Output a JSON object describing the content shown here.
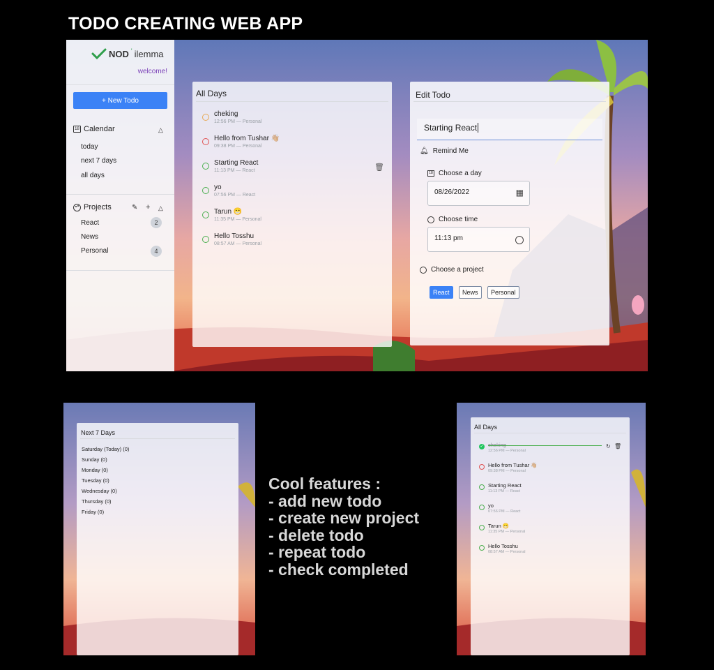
{
  "headline": "TODO CREATING WEB APP",
  "colors": {
    "accent": "#3b82f6",
    "brand_check": "#2e9e4a",
    "welcome": "#7a3fb7",
    "background": "#000000"
  },
  "app": {
    "logo": {
      "icon": "check-icon",
      "nod": "NOD",
      "d": "'",
      "rest": "ilemma"
    },
    "welcome": "welcome!",
    "new_todo_label": "+ New Todo",
    "calendar": {
      "title": "Calendar",
      "icon": "calendar-icon",
      "items": [
        "today",
        "next 7 days",
        "all days"
      ]
    },
    "projects": {
      "title": "Projects",
      "icon": "palette-icon",
      "items": [
        {
          "name": "React",
          "count": "2"
        },
        {
          "name": "News",
          "count": ""
        },
        {
          "name": "Personal",
          "count": "4"
        }
      ]
    },
    "list_panel": {
      "title": "All Days",
      "todos": [
        {
          "text": "cheking",
          "meta": "12:56 PM — Personal",
          "circle_color": "#e8a854"
        },
        {
          "text": "Hello from Tushar 👋🏼",
          "meta": "09:38 PM — Personal",
          "circle_color": "#e05252"
        },
        {
          "text": "Starting React",
          "meta": "11:13 PM — React",
          "circle_color": "#4caf50"
        },
        {
          "text": "yo",
          "meta": "07:56 PM — React",
          "circle_color": "#4caf50"
        },
        {
          "text": "Tarun 😁",
          "meta": "11:35 PM — Personal",
          "circle_color": "#4caf50"
        },
        {
          "text": "Hello Tosshu",
          "meta": "08:57 AM — Personal",
          "circle_color": "#4caf50"
        }
      ]
    },
    "edit_panel": {
      "title": "Edit Todo",
      "text_value": "Starting React",
      "remind_label": "Remind Me",
      "choose_day_label": "Choose a day",
      "date_value": "08/26/2022",
      "choose_time_label": "Choose time",
      "time_value": "11:13 pm",
      "choose_project_label": "Choose a project",
      "projects": [
        "React",
        "News",
        "Personal"
      ],
      "selected_project": "React"
    }
  },
  "next7": {
    "title": "Next 7 Days",
    "days": [
      "Saturday (Today)  (0)",
      "Sunday  (0)",
      "Monday  (0)",
      "Tuesday  (0)",
      "Wednesday  (0)",
      "Thursday  (0)",
      "Friday  (0)"
    ]
  },
  "all_days_small": {
    "title": "All Days",
    "todos": [
      {
        "text": "cheking",
        "meta": "12:56 PM — Personal",
        "completed": true
      },
      {
        "text": "Hello from Tushar 👋🏼",
        "meta": "09:38 PM — Personal",
        "circle_color": "#e05252"
      },
      {
        "text": "Starting React",
        "meta": "11:13 PM — React",
        "circle_color": "#4caf50"
      },
      {
        "text": "yo",
        "meta": "07:56 PM — React",
        "circle_color": "#4caf50"
      },
      {
        "text": "Tarun 😁",
        "meta": "11:35 PM — Personal",
        "circle_color": "#4caf50"
      },
      {
        "text": "Hello Tosshu",
        "meta": "08:57 AM — Personal",
        "circle_color": "#4caf50"
      }
    ]
  },
  "features": {
    "heading": "Cool features :",
    "items": [
      "- add new todo",
      "- create new project",
      "- delete todo",
      "- repeat todo",
      "- check completed"
    ]
  }
}
